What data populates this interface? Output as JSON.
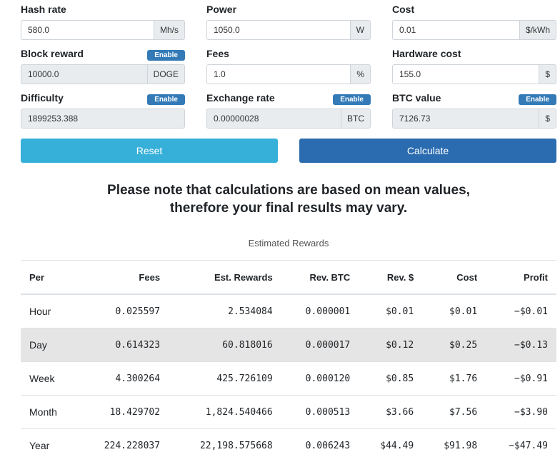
{
  "fields": [
    {
      "label": "Hash rate",
      "value": "580.0",
      "unit": "Mh/s",
      "readonly": false,
      "badge": ""
    },
    {
      "label": "Power",
      "value": "1050.0",
      "unit": "W",
      "readonly": false,
      "badge": ""
    },
    {
      "label": "Cost",
      "value": "0.01",
      "unit": "$/kWh",
      "readonly": false,
      "badge": ""
    },
    {
      "label": "Block reward",
      "value": "10000.0",
      "unit": "DOGE",
      "readonly": true,
      "badge": "Enable"
    },
    {
      "label": "Fees",
      "value": "1.0",
      "unit": "%",
      "readonly": false,
      "badge": ""
    },
    {
      "label": "Hardware cost",
      "value": "155.0",
      "unit": "$",
      "readonly": false,
      "badge": ""
    },
    {
      "label": "Difficulty",
      "value": "1899253.388",
      "unit": "",
      "readonly": true,
      "badge": "Enable"
    },
    {
      "label": "Exchange rate",
      "value": "0.00000028",
      "unit": "BTC",
      "readonly": true,
      "badge": "Enable"
    },
    {
      "label": "BTC value",
      "value": "7126.73",
      "unit": "$",
      "readonly": true,
      "badge": "Enable"
    }
  ],
  "buttons": {
    "reset": "Reset",
    "calculate": "Calculate"
  },
  "note": {
    "line1": "Please note that calculations are based on mean values,",
    "line2": "therefore your final results may vary."
  },
  "table": {
    "caption": "Estimated Rewards",
    "headers": [
      "Per",
      "Fees",
      "Est. Rewards",
      "Rev. BTC",
      "Rev. $",
      "Cost",
      "Profit"
    ],
    "rows": [
      [
        "Hour",
        "0.025597",
        "2.534084",
        "0.000001",
        "$0.01",
        "$0.01",
        "−$0.01"
      ],
      [
        "Day",
        "0.614323",
        "60.818016",
        "0.000017",
        "$0.12",
        "$0.25",
        "−$0.13"
      ],
      [
        "Week",
        "4.300264",
        "425.726109",
        "0.000120",
        "$0.85",
        "$1.76",
        "−$0.91"
      ],
      [
        "Month",
        "18.429702",
        "1,824.540466",
        "0.000513",
        "$3.66",
        "$7.56",
        "−$3.90"
      ],
      [
        "Year",
        "224.228037",
        "22,198.575668",
        "0.006243",
        "$44.49",
        "$91.98",
        "−$47.49"
      ]
    ]
  }
}
